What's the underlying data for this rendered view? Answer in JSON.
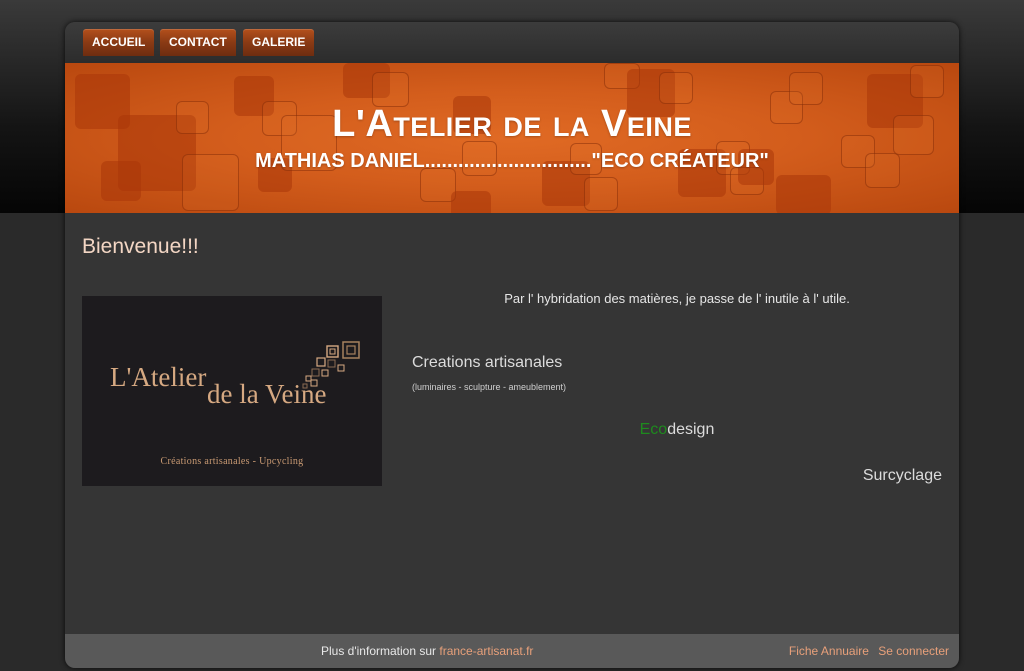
{
  "nav": {
    "items": [
      {
        "label": "ACCUEIL"
      },
      {
        "label": "CONTACT"
      },
      {
        "label": "GALERIE"
      }
    ]
  },
  "banner": {
    "title": "L'Atelier de la Veine",
    "subtitle": "MATHIAS DANIEL..............................\"ECO CRÉATEUR\""
  },
  "main": {
    "welcome": "Bienvenue!!!",
    "logo": {
      "line1": "L'Atelier",
      "line2": "de la Veine",
      "tagline": "Créations artisanales - Upcycling"
    },
    "intro": "Par l' hybridation des matières, je passe de l' inutile à l' utile.",
    "creations_title": "Creations artisanales",
    "creations_sub": "(luminaires - sculpture - ameublement)",
    "ecodesign_prefix": "Eco",
    "ecodesign_suffix": "design",
    "surcyclage": "Surcyclage"
  },
  "footer": {
    "info_text": "Plus d'information sur",
    "info_link": "france-artisanat.fr",
    "annuaire_link": "Fiche Annuaire",
    "login_link": "Se connecter"
  },
  "colors": {
    "accent": "#d35d1c",
    "welcome": "#f3d6c4",
    "eco_green": "#1e8a1e",
    "link": "#e8a07a"
  }
}
